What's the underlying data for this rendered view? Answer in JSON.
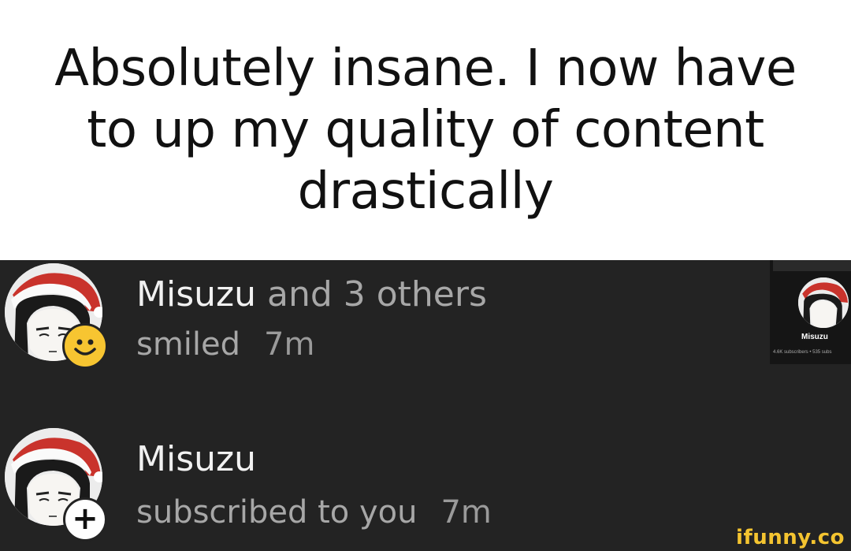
{
  "caption": {
    "text": "Absolutely insane. I now have to up my quality of content drastically"
  },
  "notifications": [
    {
      "name": "Misuzu",
      "connector": "and 3 others",
      "action": "smiled",
      "time": "7m",
      "badge_icon": "smile-icon"
    },
    {
      "name": "Misuzu",
      "action": "subscribed to you",
      "time": "7m",
      "badge_icon": "plus-icon",
      "badge_symbol": "+"
    }
  ],
  "thumbnail": {
    "channel_name": "Misuzu",
    "stats": "4.6K subscribers • 535 subs"
  },
  "watermark": "ifunny.co",
  "colors": {
    "panel_background": "#232323",
    "badge_smile": "#f7c531",
    "watermark": "#f4c430"
  }
}
